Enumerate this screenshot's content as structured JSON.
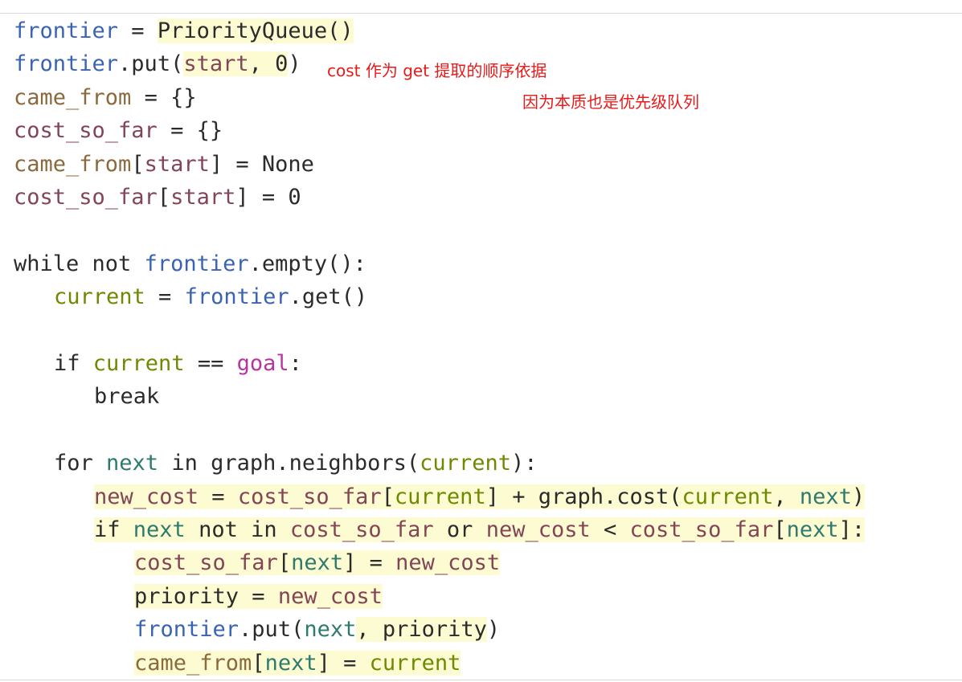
{
  "colors": {
    "plain": "#2b2b2b",
    "blue": "#3b63b3",
    "brown": "#8a6a3c",
    "maroon": "#834556",
    "olive": "#6d8a00",
    "teal": "#2f7a6e",
    "magenta": "#b7359f",
    "annotation_red": "#e81a1a",
    "highlight": "#fdfbd2"
  },
  "annotations": [
    {
      "text": "cost 作为 get 提取的顺序依据"
    },
    {
      "text": "因为本质也是优先级队列"
    }
  ],
  "code": {
    "lines": [
      {
        "indent": 0,
        "tokens": [
          {
            "t": "frontier",
            "c": "blue"
          },
          {
            "t": " = "
          },
          {
            "t": "PriorityQueue()",
            "hl": true
          }
        ]
      },
      {
        "indent": 0,
        "tokens": [
          {
            "t": "frontier",
            "c": "blue"
          },
          {
            "t": ".put("
          },
          {
            "t": "start",
            "c": "maroon",
            "hl": true
          },
          {
            "t": ", 0",
            "hl": true
          },
          {
            "t": ")"
          }
        ]
      },
      {
        "indent": 0,
        "tokens": [
          {
            "t": "came_from",
            "c": "brown"
          },
          {
            "t": " = {}"
          }
        ]
      },
      {
        "indent": 0,
        "tokens": [
          {
            "t": "cost_so_far",
            "c": "maroon"
          },
          {
            "t": " = {}"
          }
        ]
      },
      {
        "indent": 0,
        "tokens": [
          {
            "t": "came_from",
            "c": "brown"
          },
          {
            "t": "["
          },
          {
            "t": "start",
            "c": "maroon"
          },
          {
            "t": "] = None"
          }
        ]
      },
      {
        "indent": 0,
        "tokens": [
          {
            "t": "cost_so_far",
            "c": "maroon"
          },
          {
            "t": "["
          },
          {
            "t": "start",
            "c": "maroon"
          },
          {
            "t": "] = 0"
          }
        ]
      },
      {
        "indent": 0,
        "tokens": []
      },
      {
        "indent": 0,
        "tokens": [
          {
            "t": "while not "
          },
          {
            "t": "frontier",
            "c": "blue"
          },
          {
            "t": ".empty():"
          }
        ]
      },
      {
        "indent": 1,
        "tokens": [
          {
            "t": "current",
            "c": "olive"
          },
          {
            "t": " = "
          },
          {
            "t": "frontier",
            "c": "blue"
          },
          {
            "t": ".get()"
          }
        ]
      },
      {
        "indent": 0,
        "tokens": []
      },
      {
        "indent": 1,
        "tokens": [
          {
            "t": "if "
          },
          {
            "t": "current",
            "c": "olive"
          },
          {
            "t": " == "
          },
          {
            "t": "goal",
            "c": "magenta"
          },
          {
            "t": ":"
          }
        ]
      },
      {
        "indent": 2,
        "tokens": [
          {
            "t": "break"
          }
        ]
      },
      {
        "indent": 0,
        "tokens": []
      },
      {
        "indent": 1,
        "tokens": [
          {
            "t": "for "
          },
          {
            "t": "next",
            "c": "teal"
          },
          {
            "t": " in graph.neighbors("
          },
          {
            "t": "current",
            "c": "olive"
          },
          {
            "t": "):"
          }
        ]
      },
      {
        "indent": 2,
        "tokens": [
          {
            "t": "new_cost",
            "c": "maroon",
            "hl": true
          },
          {
            "t": " = ",
            "hl": true
          },
          {
            "t": "cost_so_far",
            "c": "maroon",
            "hl": true
          },
          {
            "t": "[",
            "hl": true
          },
          {
            "t": "current",
            "c": "olive",
            "hl": true
          },
          {
            "t": "] + graph.cost(",
            "hl": true
          },
          {
            "t": "current",
            "c": "olive",
            "hl": true
          },
          {
            "t": ", ",
            "hl": true
          },
          {
            "t": "next",
            "c": "teal",
            "hl": true
          },
          {
            "t": ")",
            "hl": true
          }
        ]
      },
      {
        "indent": 2,
        "tokens": [
          {
            "t": "if ",
            "hl": true
          },
          {
            "t": "next",
            "c": "teal",
            "hl": true
          },
          {
            "t": " not in ",
            "hl": true
          },
          {
            "t": "cost_so_far",
            "c": "maroon",
            "hl": true
          },
          {
            "t": " or ",
            "hl": true
          },
          {
            "t": "new_cost",
            "c": "maroon",
            "hl": true
          },
          {
            "t": " < ",
            "hl": true
          },
          {
            "t": "cost_so_far",
            "c": "maroon",
            "hl": true
          },
          {
            "t": "[",
            "hl": true
          },
          {
            "t": "next",
            "c": "teal",
            "hl": true
          },
          {
            "t": "]:",
            "hl": true
          }
        ]
      },
      {
        "indent": 3,
        "tokens": [
          {
            "t": "cost_so_far",
            "c": "maroon",
            "hl": true
          },
          {
            "t": "[",
            "hl": true
          },
          {
            "t": "next",
            "c": "teal",
            "hl": true
          },
          {
            "t": "] = ",
            "hl": true
          },
          {
            "t": "new_cost",
            "c": "maroon",
            "hl": true
          }
        ]
      },
      {
        "indent": 3,
        "tokens": [
          {
            "t": "priority = ",
            "hl": true
          },
          {
            "t": "new_cost",
            "c": "maroon",
            "hl": true
          }
        ]
      },
      {
        "indent": 3,
        "tokens": [
          {
            "t": "frontier",
            "c": "blue"
          },
          {
            "t": ".put("
          },
          {
            "t": "next",
            "c": "teal"
          },
          {
            "t": ", priority",
            "hl": true
          },
          {
            "t": ")"
          }
        ]
      },
      {
        "indent": 3,
        "tokens": [
          {
            "t": "came_from",
            "c": "brown",
            "hl": true
          },
          {
            "t": "[",
            "hl": true
          },
          {
            "t": "next",
            "c": "teal",
            "hl": true
          },
          {
            "t": "] = ",
            "hl": true
          },
          {
            "t": "current",
            "c": "olive",
            "hl": true
          }
        ]
      }
    ]
  }
}
